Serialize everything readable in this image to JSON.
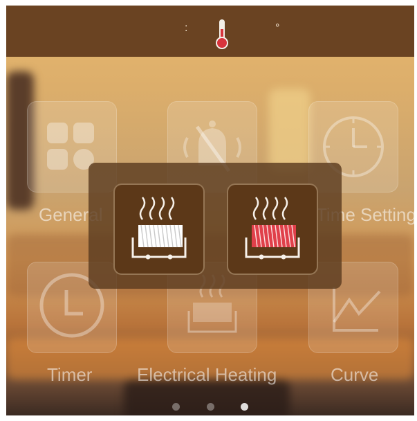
{
  "header": {
    "colon": ":",
    "degree": "°"
  },
  "tiles": [
    {
      "label": "General",
      "icon": "grid-icon"
    },
    {
      "label": "Mute",
      "icon": "bell-muted-icon"
    },
    {
      "label": "Time Setting",
      "icon": "clock-icon"
    },
    {
      "label": "Timer",
      "icon": "timer-icon"
    },
    {
      "label": "Electrical Heating",
      "icon": "heater-icon"
    },
    {
      "label": "Curve",
      "icon": "chart-curve-icon"
    }
  ],
  "popup": {
    "options": [
      {
        "name": "heating-off",
        "icon": "heater-off-icon",
        "coil_color": "#ffffff"
      },
      {
        "name": "heating-on",
        "icon": "heater-on-icon",
        "coil_color": "#e0404a"
      }
    ]
  },
  "pager": {
    "count": 3,
    "active": 3
  }
}
